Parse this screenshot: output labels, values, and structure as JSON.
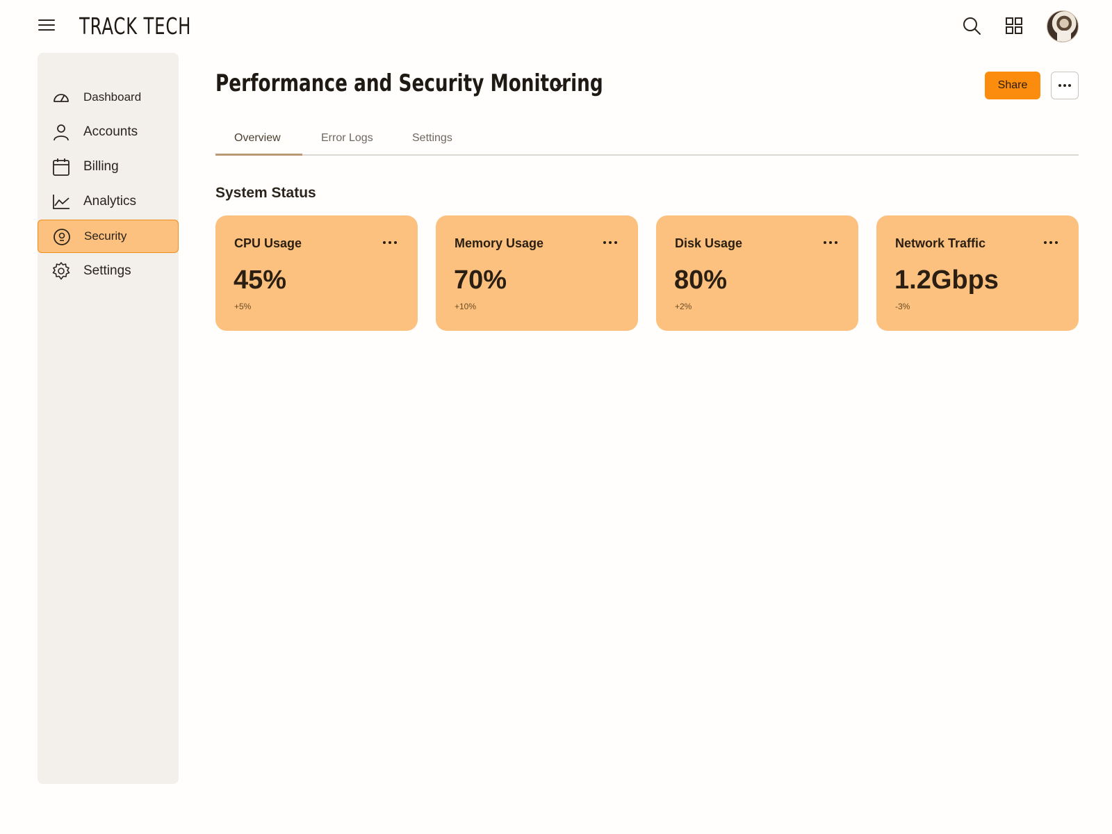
{
  "app": {
    "brand": "TRACK TECH"
  },
  "sidebar": {
    "items": [
      {
        "label": "Dashboard",
        "icon": "gauge-icon"
      },
      {
        "label": "Accounts",
        "icon": "user-icon"
      },
      {
        "label": "Billing",
        "icon": "calendar-icon"
      },
      {
        "label": "Analytics",
        "icon": "line-chart-icon"
      },
      {
        "label": "Security",
        "icon": "shield-lock-icon",
        "active": true
      },
      {
        "label": "Settings",
        "icon": "gear-icon"
      }
    ]
  },
  "header": {
    "title": "Performance and Security Monitoring",
    "share_label": "Share"
  },
  "tabs": [
    {
      "label": "Overview",
      "active": true
    },
    {
      "label": "Error Logs"
    },
    {
      "label": "Settings"
    }
  ],
  "section": {
    "title": "System Status"
  },
  "cards": [
    {
      "title": "CPU Usage",
      "value": "45%",
      "delta": "+5%"
    },
    {
      "title": "Memory Usage",
      "value": "70%",
      "delta": "+10%"
    },
    {
      "title": "Disk Usage",
      "value": "80%",
      "delta": "+2%"
    },
    {
      "title": "Network Traffic",
      "value": "1.2Gbps",
      "delta": "-3%"
    }
  ],
  "colors": {
    "accent": "#fb8c0d",
    "card_bg": "#fcc17e",
    "sidebar_bg": "#f3efea"
  }
}
